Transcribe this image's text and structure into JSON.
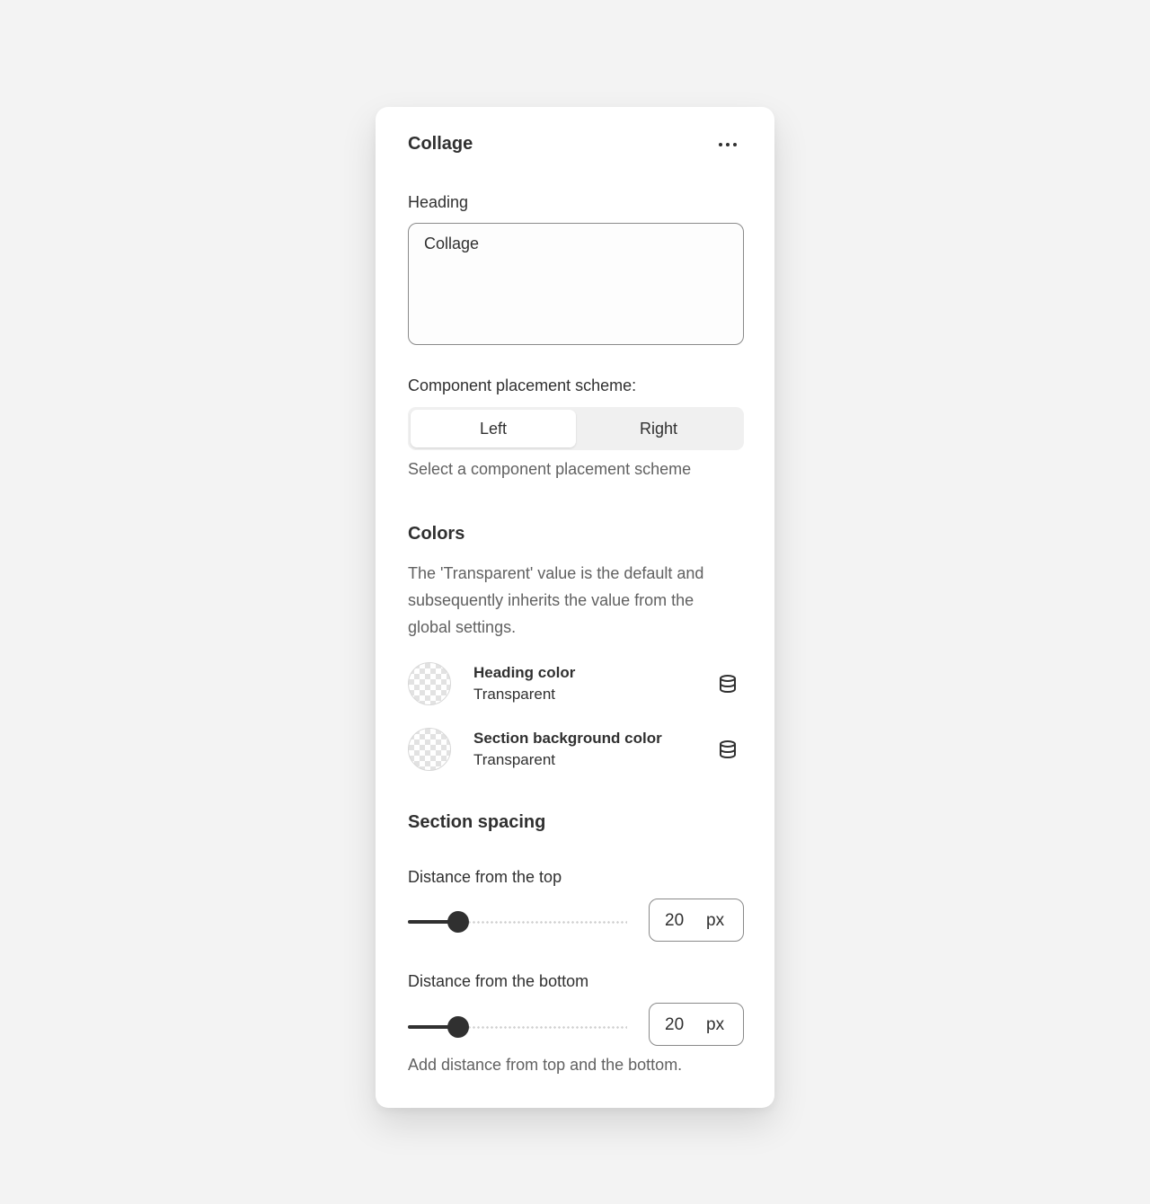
{
  "panel": {
    "title": "Collage",
    "more_icon": "ellipsis-horizontal-icon"
  },
  "heading_field": {
    "label": "Heading",
    "value": "Collage"
  },
  "placement": {
    "label": "Component placement scheme:",
    "options": [
      "Left",
      "Right"
    ],
    "selected": "Left",
    "help": "Select a component placement scheme"
  },
  "colors": {
    "title": "Colors",
    "description": "The 'Transparent' value is the default and subsequently inherits the value from the global settings.",
    "items": [
      {
        "name": "Heading color",
        "value": "Transparent",
        "icon": "database-icon"
      },
      {
        "name": "Section background color",
        "value": "Transparent",
        "icon": "database-icon"
      }
    ]
  },
  "spacing": {
    "title": "Section spacing",
    "top": {
      "label": "Distance from the top",
      "value": "20",
      "unit": "px"
    },
    "bottom": {
      "label": "Distance from the bottom",
      "value": "20",
      "unit": "px"
    },
    "help": "Add distance from top and the bottom."
  },
  "theme": {
    "text": "#303030",
    "muted": "#616161",
    "border": "#8a8a8a",
    "background": "#f3f3f3"
  }
}
